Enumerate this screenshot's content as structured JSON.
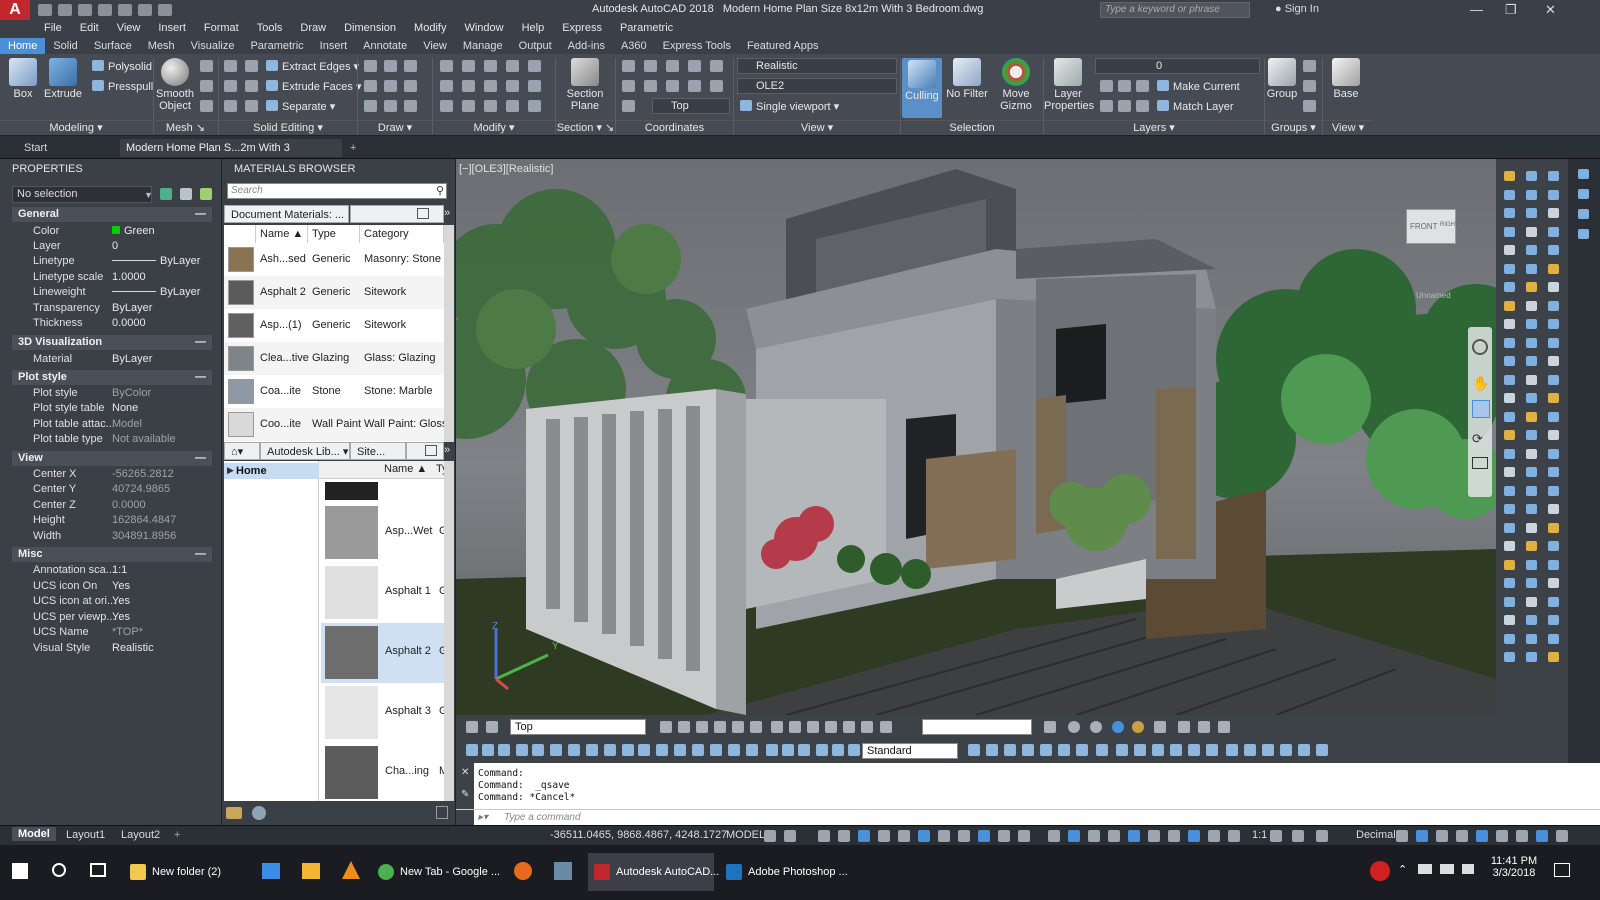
{
  "app": {
    "title": "Autodesk AutoCAD 2018",
    "document": "Modern Home Plan Size 8x12m With 3 Bedroom.dwg",
    "search_placeholder": "Type a keyword or phrase",
    "sign_in": "Sign In",
    "logo": "A"
  },
  "menu": [
    "File",
    "Edit",
    "View",
    "Insert",
    "Format",
    "Tools",
    "Draw",
    "Dimension",
    "Modify",
    "Window",
    "Help",
    "Express",
    "Parametric"
  ],
  "ribbon_tabs": [
    "Home",
    "Solid",
    "Surface",
    "Mesh",
    "Visualize",
    "Parametric",
    "Insert",
    "Annotate",
    "View",
    "Manage",
    "Output",
    "Add-ins",
    "A360",
    "Express Tools",
    "Featured Apps"
  ],
  "ribbon": {
    "box": "Box",
    "extrude": "Extrude",
    "polysolid": "Polysolid",
    "presspull": "Presspull",
    "smooth_object_1": "Smooth",
    "smooth_object_2": "Object",
    "extract_edges": "Extract Edges",
    "extrude_faces": "Extrude Faces",
    "separate": "Separate",
    "section_plane_1": "Section",
    "section_plane_2": "Plane",
    "visual_style": "Realistic",
    "view_name": "OLE2",
    "view_top": "Top",
    "single_viewport": "Single viewport",
    "culling": "Culling",
    "no_filter": "No Filter",
    "move_gizmo_1": "Move",
    "move_gizmo_2": "Gizmo",
    "layer_props_1": "Layer",
    "layer_props_2": "Properties",
    "layer_value": "0",
    "make_current": "Make Current",
    "match_layer": "Match Layer",
    "group": "Group",
    "base": "Base",
    "groups": {
      "modeling": "Modeling",
      "mesh": "Mesh",
      "solid_editing": "Solid Editing",
      "draw": "Draw",
      "modify": "Modify",
      "section": "Section",
      "coordinates": "Coordinates",
      "view": "View",
      "selection": "Selection",
      "layers": "Layers",
      "groups": "Groups",
      "view2": "View"
    }
  },
  "doc_tabs": {
    "start": "Start",
    "active": "Modern Home Plan S...2m With 3 Bedroom"
  },
  "properties": {
    "title": "PROPERTIES",
    "selection": "No selection",
    "sections": {
      "general": "General",
      "viz": "3D Visualization",
      "plot": "Plot style",
      "view": "View",
      "misc": "Misc"
    },
    "general": [
      {
        "k": "Color",
        "v": "Green"
      },
      {
        "k": "Layer",
        "v": "0"
      },
      {
        "k": "Linetype",
        "v": "ByLayer"
      },
      {
        "k": "Linetype scale",
        "v": "1.0000"
      },
      {
        "k": "Lineweight",
        "v": "ByLayer"
      },
      {
        "k": "Transparency",
        "v": "ByLayer"
      },
      {
        "k": "Thickness",
        "v": "0.0000"
      }
    ],
    "viz": [
      {
        "k": "Material",
        "v": "ByLayer"
      }
    ],
    "plot": [
      {
        "k": "Plot style",
        "v": "ByColor"
      },
      {
        "k": "Plot style table",
        "v": "None"
      },
      {
        "k": "Plot table attac...",
        "v": "Model"
      },
      {
        "k": "Plot table type",
        "v": "Not available"
      }
    ],
    "view": [
      {
        "k": "Center X",
        "v": "-56265.2812"
      },
      {
        "k": "Center Y",
        "v": "40724.9865"
      },
      {
        "k": "Center Z",
        "v": "0.0000"
      },
      {
        "k": "Height",
        "v": "162864.4847"
      },
      {
        "k": "Width",
        "v": "304891.8956"
      }
    ],
    "misc": [
      {
        "k": "Annotation sca...",
        "v": "1:1"
      },
      {
        "k": "UCS icon On",
        "v": "Yes"
      },
      {
        "k": "UCS icon at ori...",
        "v": "Yes"
      },
      {
        "k": "UCS per viewp...",
        "v": "Yes"
      },
      {
        "k": "UCS Name",
        "v": "*TOP*"
      },
      {
        "k": "Visual Style",
        "v": "Realistic"
      }
    ]
  },
  "materials": {
    "title": "MATERIALS BROWSER",
    "search_placeholder": "Search",
    "doc_crumb": "Document Materials: ...",
    "cols": {
      "name": "Name",
      "type": "Type",
      "category": "Category"
    },
    "rows": [
      {
        "name": "Ash...sed",
        "type": "Generic",
        "cat": "Masonry: Stone",
        "sw": "#8a7352"
      },
      {
        "name": "Asphalt 2",
        "type": "Generic",
        "cat": "Sitework",
        "sw": "#5a5a5a"
      },
      {
        "name": "Asp...(1)",
        "type": "Generic",
        "cat": "Sitework",
        "sw": "#606060"
      },
      {
        "name": "Clea...tive",
        "type": "Glazing",
        "cat": "Glass: Glazing",
        "sw": "#7d8588"
      },
      {
        "name": "Coa...ite",
        "type": "Stone",
        "cat": "Stone: Marble",
        "sw": "#8e99a3"
      },
      {
        "name": "Coo...ite",
        "type": "Wall Paint",
        "cat": "Wall Paint: Glossy",
        "sw": "#d9d9d9"
      }
    ],
    "lib_crumb1": "Autodesk Lib...",
    "lib_crumb2": "Site...",
    "lib_home": "Home",
    "lib_col_name": "Name",
    "lib_col_type": "Ty",
    "lib_rows": [
      {
        "name": "",
        "type": "",
        "sw": "#222222"
      },
      {
        "name": "Asp...Wet",
        "type": "G",
        "sw": "#9a9a9a"
      },
      {
        "name": "Asphalt 1",
        "type": "G",
        "sw": "#e0e0e0"
      },
      {
        "name": "Asphalt 2",
        "type": "G",
        "sw": "#6e6e6e"
      },
      {
        "name": "Asphalt 3",
        "type": "G",
        "sw": "#e6e6e6"
      },
      {
        "name": "Cha...ing",
        "type": "M",
        "sw": "#5c5c5c"
      }
    ]
  },
  "viewport": {
    "label": "[−][OLE3][Realistic]",
    "cube_front": "FRONT",
    "cube_right": "RIGHT",
    "unnamed": "Unnamed",
    "ucs_y": "Y",
    "ucs_z": "Z"
  },
  "bottom_toolbar": {
    "view_top": "Top",
    "dim_style": "Standard"
  },
  "command": {
    "history": [
      "Command:",
      "Command:  _qsave",
      "Command: *Cancel*"
    ],
    "placeholder": "Type a command"
  },
  "status": {
    "model_tab": "Model",
    "layout1": "Layout1",
    "layout2": "Layout2",
    "coords": "-36511.0465, 9868.4867, 4248.1727",
    "model": "MODEL",
    "scale": "1:1",
    "units": "Decimal"
  },
  "taskbar": {
    "items": [
      {
        "label": "New folder (2)",
        "color": "#f2c94c"
      },
      {
        "label": "New Tab - Google ...",
        "color": "#4caf50"
      },
      {
        "label": "Autodesk AutoCAD...",
        "color": "#c1272d"
      },
      {
        "label": "Adobe Photoshop ...",
        "color": "#1e73be"
      }
    ],
    "time": "11:41 PM",
    "date": "3/3/2018"
  },
  "colors": {
    "accent": "#4a90d9",
    "autocad_red": "#c1272d",
    "panel": "#3b3f46",
    "title": "#3b4048"
  }
}
